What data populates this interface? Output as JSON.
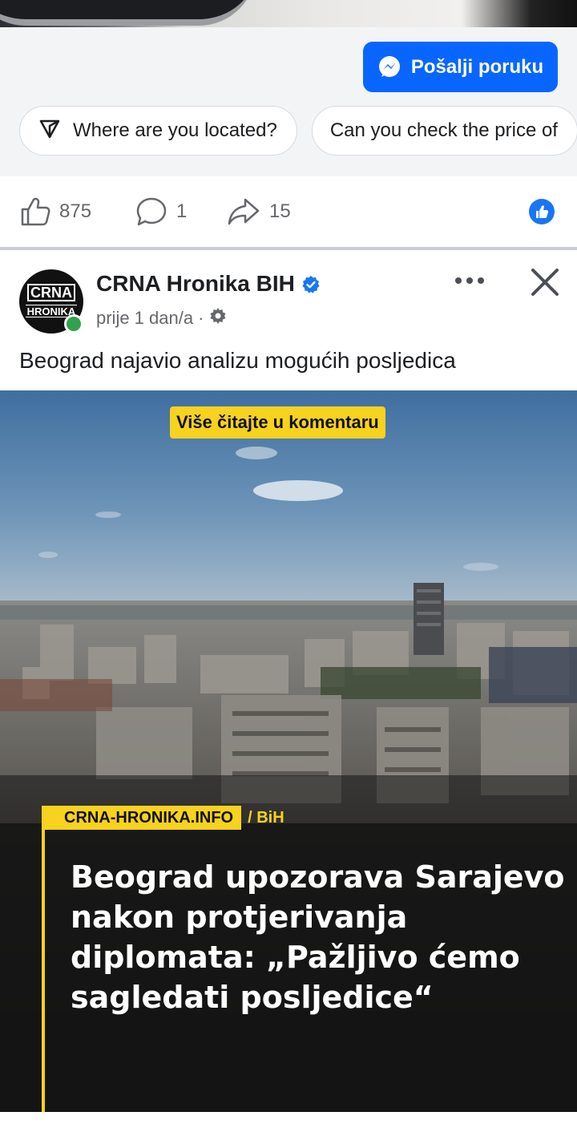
{
  "cta": {
    "send_message_label": "Pošalji poruku",
    "chips": [
      {
        "label": "Where are you located?"
      },
      {
        "label": "Can you check the price of"
      }
    ]
  },
  "reactions": {
    "likes": "875",
    "comments": "1",
    "shares": "15"
  },
  "post": {
    "page_name": "CRNA Hronika BIH",
    "avatar_line1": "CRNA",
    "avatar_line2": "HRONIKA",
    "time": "prije 1 dan/a",
    "time_separator": "·",
    "caption": "Beograd najavio analizu mogućih posljedica",
    "image": {
      "read_more_banner": "Više čitajte u komentaru",
      "site_tag": "CRNA-HRONIKA.INFO",
      "category": "/ BiH",
      "headline": "Beograd upozorava Sarajevo nakon protjerivanja diplomata: „Pažljivo ćemo sagledati posljedice“"
    }
  },
  "colors": {
    "accent_blue": "#0866ff",
    "verified_blue": "#1877f2",
    "online_green": "#31a24c",
    "brand_yellow": "#f7d21e"
  }
}
